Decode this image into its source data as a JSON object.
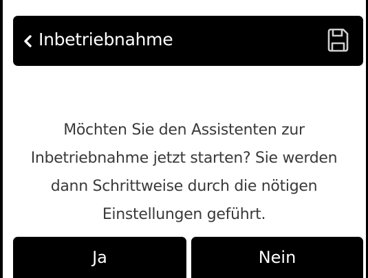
{
  "header": {
    "title": "Inbetriebnahme",
    "back_icon": "chevron-left-icon",
    "save_icon": "floppy-disk-icon"
  },
  "message": {
    "text": "Möchten Sie den Assistenten zur Inbetriebnahme jetzt starten? Sie werden dann Schrittweise durch die nötigen Einstellungen geführt."
  },
  "buttons": {
    "yes_label": "Ja",
    "no_label": "Nein"
  },
  "colors": {
    "background": "#ffffff",
    "bar": "#000000",
    "text": "#3a3a3a",
    "bar_text": "#ffffff"
  }
}
